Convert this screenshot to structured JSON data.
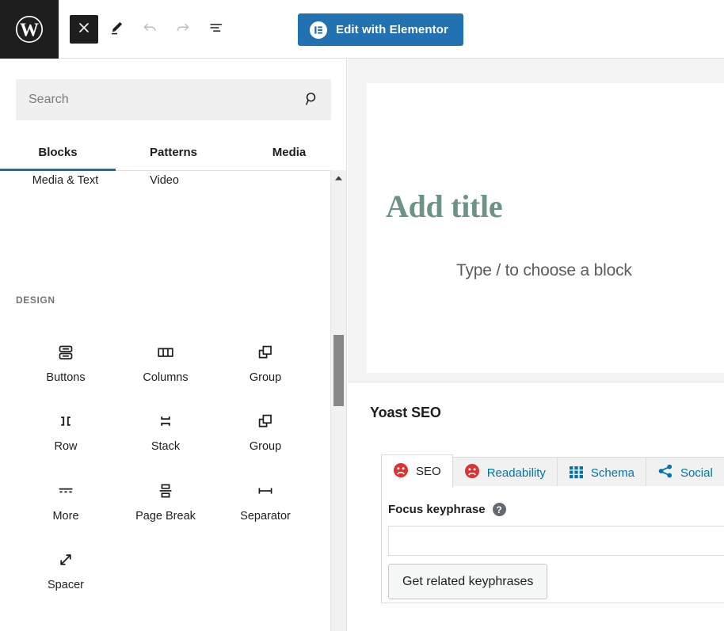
{
  "toolbar": {
    "wp_logo_label": "WordPress",
    "close_label": "Close",
    "edit_label": "Edit",
    "undo_label": "Undo",
    "redo_label": "Redo",
    "document_overview_label": "Document Overview",
    "elementor_button_label": "Edit with Elementor",
    "elementor_color": "#2271b1"
  },
  "inserter": {
    "search": {
      "placeholder": "Search",
      "value": ""
    },
    "tabs": [
      {
        "label": "Blocks",
        "active": true
      },
      {
        "label": "Patterns",
        "active": false
      },
      {
        "label": "Media",
        "active": false
      }
    ],
    "partial_row": [
      {
        "label": "Media & Text"
      },
      {
        "label": "Video"
      }
    ],
    "section_label": "DESIGN",
    "blocks": [
      {
        "label": "Buttons",
        "icon": "buttons-icon"
      },
      {
        "label": "Columns",
        "icon": "columns-icon"
      },
      {
        "label": "Group",
        "icon": "group-icon"
      },
      {
        "label": "Row",
        "icon": "row-icon"
      },
      {
        "label": "Stack",
        "icon": "stack-icon"
      },
      {
        "label": "Group",
        "icon": "group-icon"
      },
      {
        "label": "More",
        "icon": "more-icon"
      },
      {
        "label": "Page Break",
        "icon": "page-break-icon"
      },
      {
        "label": "Separator",
        "icon": "separator-icon"
      },
      {
        "label": "Spacer",
        "icon": "spacer-icon"
      }
    ],
    "active_tab_accent": "#1d6ca4"
  },
  "editor": {
    "title_placeholder": "Add title",
    "title_color": "#6d9288",
    "body_placeholder": "Type / to choose a block"
  },
  "yoast": {
    "heading": "Yoast SEO",
    "tabs": [
      {
        "label": "SEO",
        "icon": "frown-face-icon",
        "active": true
      },
      {
        "label": "Readability",
        "icon": "frown-face-icon",
        "active": false
      },
      {
        "label": "Schema",
        "icon": "grid-icon",
        "active": false
      },
      {
        "label": "Social",
        "icon": "share-icon",
        "active": false
      }
    ],
    "focus_keyphrase_label": "Focus keyphrase",
    "help_glyph": "?",
    "focus_keyphrase_value": "",
    "related_keyphrases_label": "Get related keyphrases",
    "bad_score_color": "#dc3232",
    "link_color": "#0073aa"
  }
}
